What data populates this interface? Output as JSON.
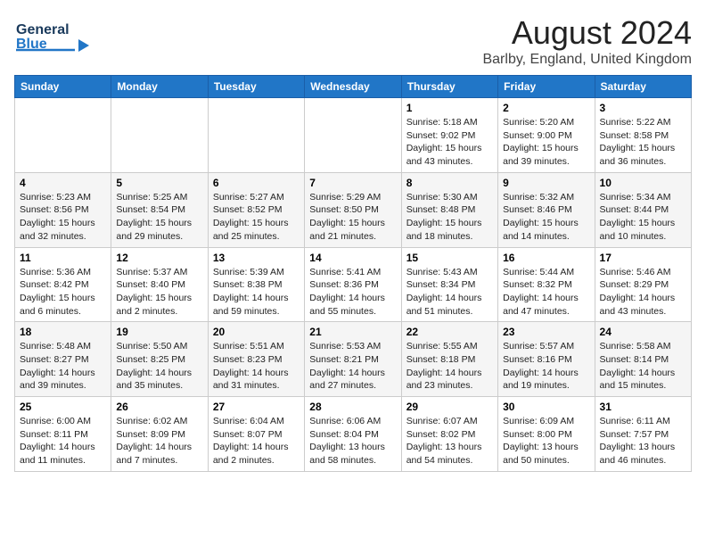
{
  "header": {
    "logo_line1": "General",
    "logo_line2": "Blue",
    "title": "August 2024",
    "subtitle": "Barlby, England, United Kingdom"
  },
  "days_of_week": [
    "Sunday",
    "Monday",
    "Tuesday",
    "Wednesday",
    "Thursday",
    "Friday",
    "Saturday"
  ],
  "weeks": [
    [
      {
        "day": "",
        "info": ""
      },
      {
        "day": "",
        "info": ""
      },
      {
        "day": "",
        "info": ""
      },
      {
        "day": "",
        "info": ""
      },
      {
        "day": "1",
        "info": "Sunrise: 5:18 AM\nSunset: 9:02 PM\nDaylight: 15 hours\nand 43 minutes."
      },
      {
        "day": "2",
        "info": "Sunrise: 5:20 AM\nSunset: 9:00 PM\nDaylight: 15 hours\nand 39 minutes."
      },
      {
        "day": "3",
        "info": "Sunrise: 5:22 AM\nSunset: 8:58 PM\nDaylight: 15 hours\nand 36 minutes."
      }
    ],
    [
      {
        "day": "4",
        "info": "Sunrise: 5:23 AM\nSunset: 8:56 PM\nDaylight: 15 hours\nand 32 minutes."
      },
      {
        "day": "5",
        "info": "Sunrise: 5:25 AM\nSunset: 8:54 PM\nDaylight: 15 hours\nand 29 minutes."
      },
      {
        "day": "6",
        "info": "Sunrise: 5:27 AM\nSunset: 8:52 PM\nDaylight: 15 hours\nand 25 minutes."
      },
      {
        "day": "7",
        "info": "Sunrise: 5:29 AM\nSunset: 8:50 PM\nDaylight: 15 hours\nand 21 minutes."
      },
      {
        "day": "8",
        "info": "Sunrise: 5:30 AM\nSunset: 8:48 PM\nDaylight: 15 hours\nand 18 minutes."
      },
      {
        "day": "9",
        "info": "Sunrise: 5:32 AM\nSunset: 8:46 PM\nDaylight: 15 hours\nand 14 minutes."
      },
      {
        "day": "10",
        "info": "Sunrise: 5:34 AM\nSunset: 8:44 PM\nDaylight: 15 hours\nand 10 minutes."
      }
    ],
    [
      {
        "day": "11",
        "info": "Sunrise: 5:36 AM\nSunset: 8:42 PM\nDaylight: 15 hours\nand 6 minutes."
      },
      {
        "day": "12",
        "info": "Sunrise: 5:37 AM\nSunset: 8:40 PM\nDaylight: 15 hours\nand 2 minutes."
      },
      {
        "day": "13",
        "info": "Sunrise: 5:39 AM\nSunset: 8:38 PM\nDaylight: 14 hours\nand 59 minutes."
      },
      {
        "day": "14",
        "info": "Sunrise: 5:41 AM\nSunset: 8:36 PM\nDaylight: 14 hours\nand 55 minutes."
      },
      {
        "day": "15",
        "info": "Sunrise: 5:43 AM\nSunset: 8:34 PM\nDaylight: 14 hours\nand 51 minutes."
      },
      {
        "day": "16",
        "info": "Sunrise: 5:44 AM\nSunset: 8:32 PM\nDaylight: 14 hours\nand 47 minutes."
      },
      {
        "day": "17",
        "info": "Sunrise: 5:46 AM\nSunset: 8:29 PM\nDaylight: 14 hours\nand 43 minutes."
      }
    ],
    [
      {
        "day": "18",
        "info": "Sunrise: 5:48 AM\nSunset: 8:27 PM\nDaylight: 14 hours\nand 39 minutes."
      },
      {
        "day": "19",
        "info": "Sunrise: 5:50 AM\nSunset: 8:25 PM\nDaylight: 14 hours\nand 35 minutes."
      },
      {
        "day": "20",
        "info": "Sunrise: 5:51 AM\nSunset: 8:23 PM\nDaylight: 14 hours\nand 31 minutes."
      },
      {
        "day": "21",
        "info": "Sunrise: 5:53 AM\nSunset: 8:21 PM\nDaylight: 14 hours\nand 27 minutes."
      },
      {
        "day": "22",
        "info": "Sunrise: 5:55 AM\nSunset: 8:18 PM\nDaylight: 14 hours\nand 23 minutes."
      },
      {
        "day": "23",
        "info": "Sunrise: 5:57 AM\nSunset: 8:16 PM\nDaylight: 14 hours\nand 19 minutes."
      },
      {
        "day": "24",
        "info": "Sunrise: 5:58 AM\nSunset: 8:14 PM\nDaylight: 14 hours\nand 15 minutes."
      }
    ],
    [
      {
        "day": "25",
        "info": "Sunrise: 6:00 AM\nSunset: 8:11 PM\nDaylight: 14 hours\nand 11 minutes."
      },
      {
        "day": "26",
        "info": "Sunrise: 6:02 AM\nSunset: 8:09 PM\nDaylight: 14 hours\nand 7 minutes."
      },
      {
        "day": "27",
        "info": "Sunrise: 6:04 AM\nSunset: 8:07 PM\nDaylight: 14 hours\nand 2 minutes."
      },
      {
        "day": "28",
        "info": "Sunrise: 6:06 AM\nSunset: 8:04 PM\nDaylight: 13 hours\nand 58 minutes."
      },
      {
        "day": "29",
        "info": "Sunrise: 6:07 AM\nSunset: 8:02 PM\nDaylight: 13 hours\nand 54 minutes."
      },
      {
        "day": "30",
        "info": "Sunrise: 6:09 AM\nSunset: 8:00 PM\nDaylight: 13 hours\nand 50 minutes."
      },
      {
        "day": "31",
        "info": "Sunrise: 6:11 AM\nSunset: 7:57 PM\nDaylight: 13 hours\nand 46 minutes."
      }
    ]
  ]
}
